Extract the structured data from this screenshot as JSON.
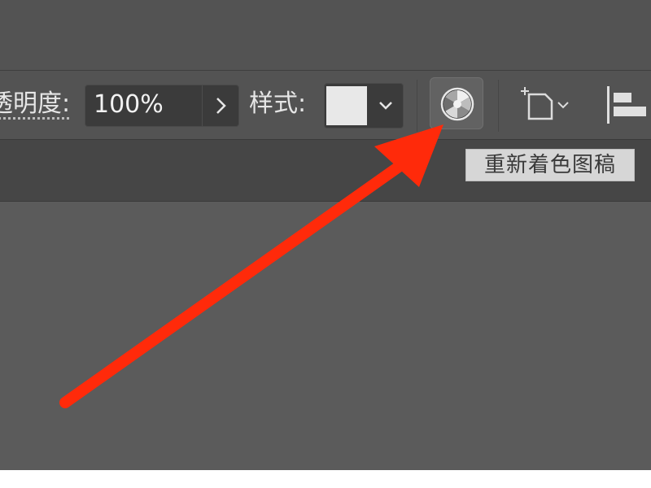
{
  "control_bar": {
    "opacity_label": "透明度:",
    "opacity_value": "100%",
    "style_label": "样式:",
    "style_swatch_color": "#e8e8e8"
  },
  "recolor_button": {
    "icon": "color-wheel-icon",
    "tooltip": "重新着色图稿"
  },
  "other_icons": [
    "chevron-right-icon",
    "chevron-down-icon",
    "shape-transform-icon",
    "align-left-icon"
  ],
  "annotation": {
    "arrow_color": "#ff2a0a",
    "arrow_target": "recolor-button"
  }
}
